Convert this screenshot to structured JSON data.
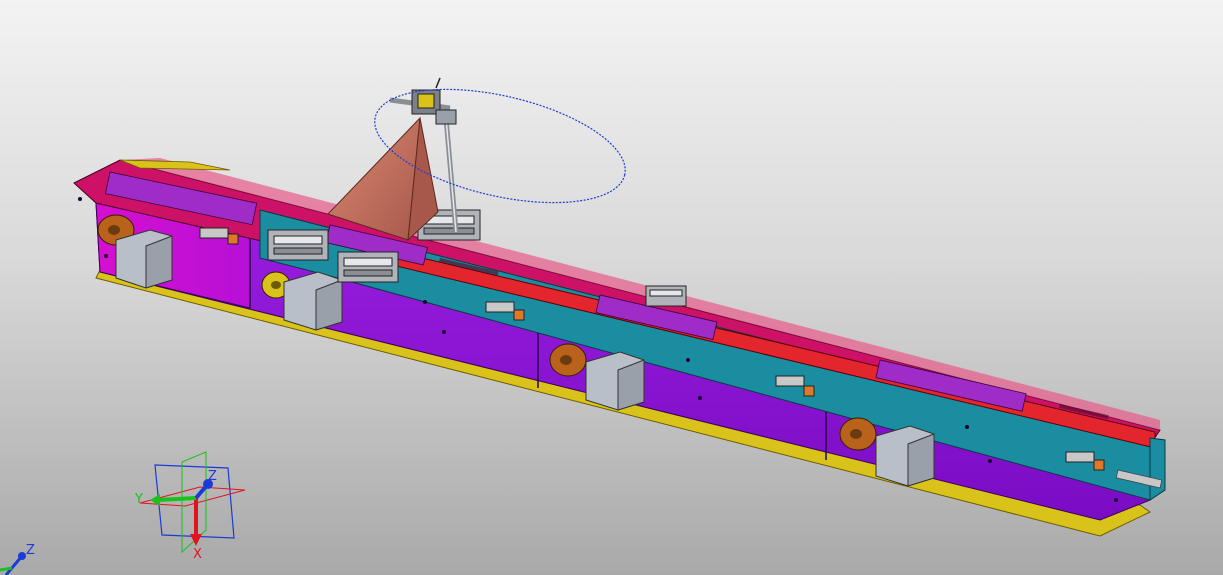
{
  "viewer": {
    "background_top": "#f3f3f3",
    "background_bottom": "#a9a9a9"
  },
  "model": {
    "frame_color": "#8a0fd4",
    "rail_color": "#cc1166",
    "base_color": "#d9c21a",
    "belt_color": "#e3262d",
    "channel_color": "#1b8da0",
    "motor_color": "#b9bfc8",
    "pulley_color": "#b8621c",
    "camera_cone_color": "#c87460",
    "orbit_color": "#1a3bd6"
  },
  "compass": {
    "x_label": "X",
    "y_label": "Y",
    "z_label": "Z",
    "x_color": "#e0141e",
    "y_color": "#18c21c",
    "z_color": "#1a3bd6"
  },
  "mini_axis": {
    "z_label": "Z"
  }
}
